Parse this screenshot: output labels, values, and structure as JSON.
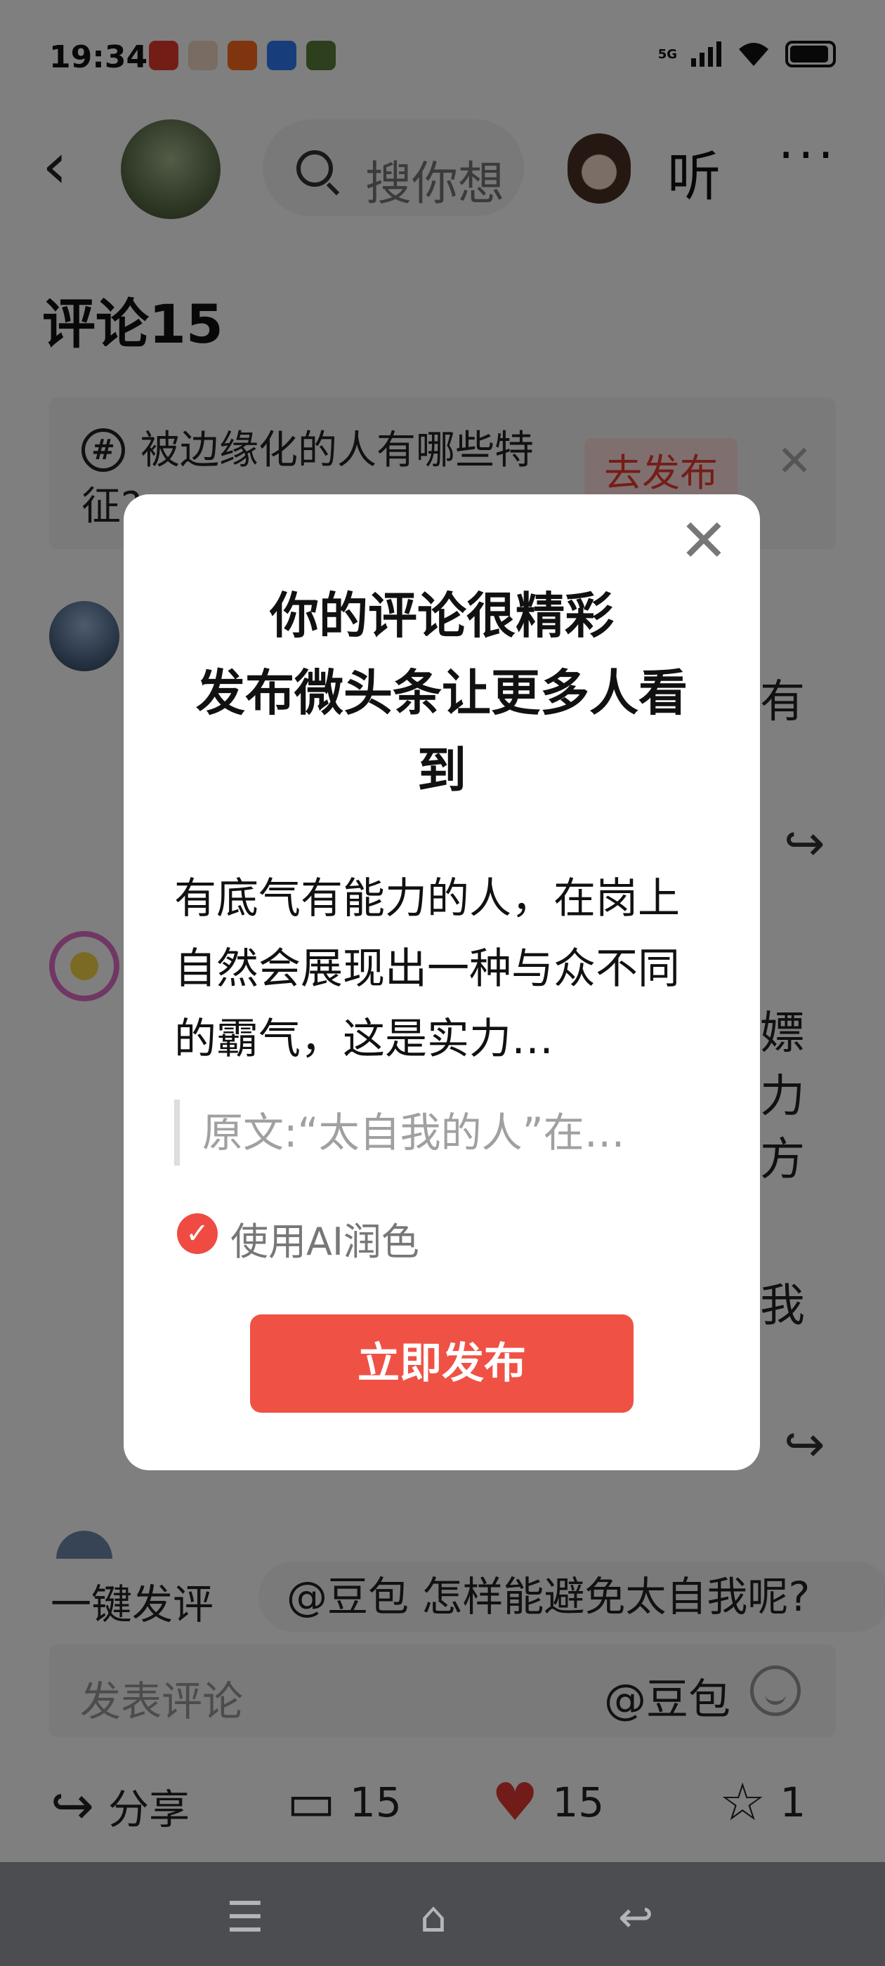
{
  "status_bar": {
    "time": "19:34",
    "network": "5G",
    "notification_icons": [
      "toutiao-icon",
      "avatar-icon",
      "app-icon",
      "baidu-icon",
      "game-icon"
    ],
    "notification_colors": [
      "#e83a2e",
      "#f3d9c7",
      "#ff6a1a",
      "#2f7cf6",
      "#5a7e3a"
    ]
  },
  "top_bar": {
    "back_glyph": "‹",
    "search_placeholder": "搜你想",
    "listen_label": "听",
    "more_glyph": "···"
  },
  "comments": {
    "title": "评论15"
  },
  "topic_card": {
    "icon_glyph": "#",
    "text": "被边缘化的人有哪些特征?",
    "button_label": "去发布",
    "close_glyph": "✕"
  },
  "background_fragments": [
    "有",
    "嫖",
    "力",
    "方",
    "我"
  ],
  "ai_suggest": {
    "label": "一键发评",
    "chip": "@豆包 怎样能避免太自我呢?"
  },
  "comment_input": {
    "placeholder": "发表评论",
    "mention": "@豆包"
  },
  "actions": {
    "share_label": "分享",
    "comment_count": "15",
    "like_count": "15",
    "favorite_count": "1",
    "like_color": "#e53935"
  },
  "modal": {
    "title": "你的评论很精彩\n发布微头条让更多人看到",
    "body": "有底气有能力的人，在岗上自然会展现出一种与众不同的霸气，这是实力…",
    "quote": "原文:“太自我的人”在…",
    "ai_polish_label": "使用AI润色",
    "ai_polish_checked": true,
    "publish_label": "立即发布",
    "close_glyph": "✕",
    "accent_color": "#ef5245"
  },
  "nav_bar": {
    "menu_glyph": "☰",
    "home_glyph": "⌂",
    "back_glyph": "↩"
  }
}
